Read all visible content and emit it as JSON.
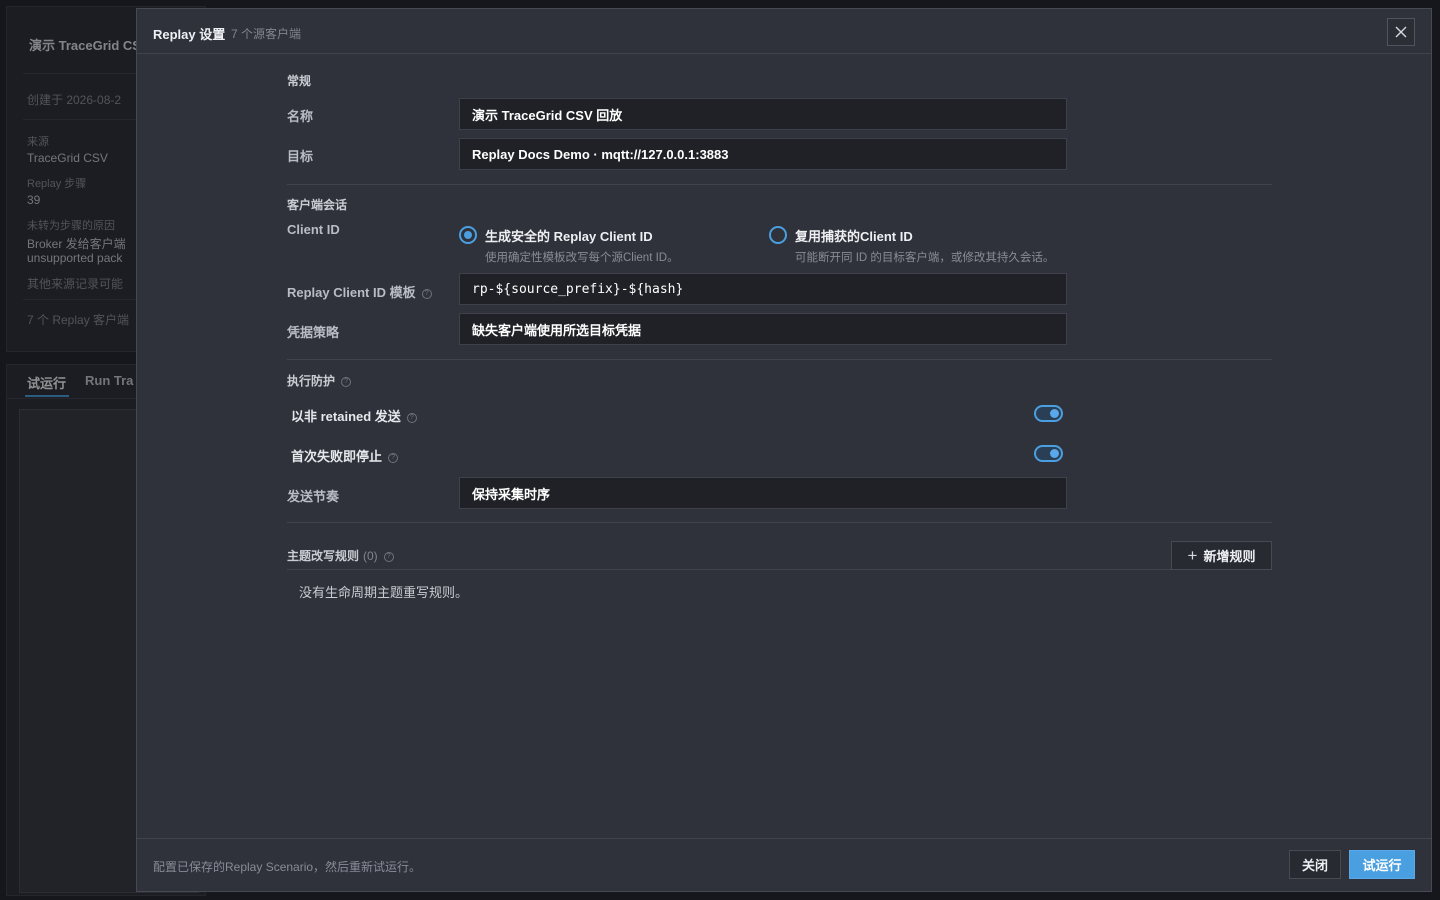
{
  "background": {
    "card_title": "演示 TraceGrid CS",
    "created": "创建于 2026-08-2",
    "source_label": "来源",
    "source_value": "TraceGrid CSV",
    "steps_label": "Replay 步骤",
    "steps_value": "39",
    "reason_label": "未转为步骤的原因",
    "reason_line1": "Broker 发给客户端",
    "reason_line2": "unsupported pack",
    "other_note": "其他来源记录可能",
    "clients_note": "7 个 Replay 客户端",
    "tabs": [
      "试运行",
      "Run Tra"
    ]
  },
  "modal": {
    "title": "Replay 设置",
    "subtitle": "7 个源客户端",
    "general": {
      "heading": "常规",
      "name_label": "名称",
      "name_value": "演示 TraceGrid CSV 回放",
      "target_label": "目标",
      "target_value": "Replay Docs Demo · mqtt://127.0.0.1:3883"
    },
    "session": {
      "heading": "客户端会话",
      "client_id_label": "Client ID",
      "option_generate_title": "生成安全的 Replay Client ID",
      "option_generate_desc": "使用确定性模板改写每个源Client ID。",
      "option_reuse_title": "复用捕获的Client ID",
      "option_reuse_desc": "可能断开同 ID 的目标客户端，或修改其持久会话。",
      "template_label": "Replay Client ID 模板",
      "template_value": "rp-${source_prefix}-${hash}",
      "credential_label": "凭据策略",
      "credential_value": "缺失客户端使用所选目标凭据"
    },
    "guard": {
      "heading": "执行防护",
      "non_retained_label": "以非 retained 发送",
      "non_retained_on": true,
      "stop_on_fail_label": "首次失败即停止",
      "stop_on_fail_on": true,
      "pacing_label": "发送节奏",
      "pacing_value": "保持采集时序"
    },
    "rules": {
      "heading": "主题改写规则",
      "count": "(0)",
      "add_label": "新增规则",
      "empty": "没有生命周期主题重写规则。"
    },
    "footer": {
      "note": "配置已保存的Replay Scenario，然后重新试运行。",
      "close_label": "关闭",
      "run_label": "试运行"
    }
  },
  "colors": {
    "accent": "#4a9fe0",
    "modal_bg": "#2f323a",
    "input_bg": "#1f2126"
  }
}
